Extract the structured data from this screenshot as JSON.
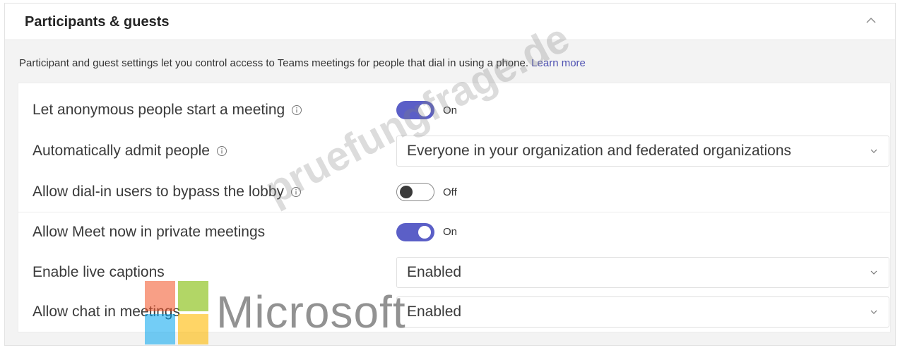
{
  "section": {
    "title": "Participants & guests",
    "description": "Participant and guest settings let you control access to Teams meetings for people that dial in using a phone.",
    "learn_more": "Learn more"
  },
  "settings": [
    {
      "label": "Let anonymous people start a meeting",
      "info_icon": true,
      "control": "toggle",
      "state": "on",
      "value": "On"
    },
    {
      "label": "Automatically admit people",
      "info_icon": true,
      "control": "dropdown",
      "value": "Everyone in your organization and federated organizations"
    },
    {
      "label": "Allow dial-in users to bypass the lobby",
      "info_icon": true,
      "control": "toggle",
      "state": "off",
      "value": "Off"
    },
    {
      "label": "Allow Meet now in private meetings",
      "info_icon": false,
      "control": "toggle",
      "state": "on",
      "value": "On"
    },
    {
      "label": "Enable live captions",
      "info_icon": false,
      "control": "dropdown",
      "value": "Enabled"
    },
    {
      "label": "Allow chat in meetings",
      "info_icon": false,
      "control": "dropdown",
      "value": "Enabled"
    }
  ],
  "overlay": {
    "watermark": "pruefungfrage.de",
    "brand_text": "Microsoft",
    "logo_colors": [
      "#f25022",
      "#7fba00",
      "#00a4ef",
      "#ffb900"
    ]
  },
  "colors": {
    "toggle_on": "#5b5fc7",
    "link": "#4f52b2"
  }
}
